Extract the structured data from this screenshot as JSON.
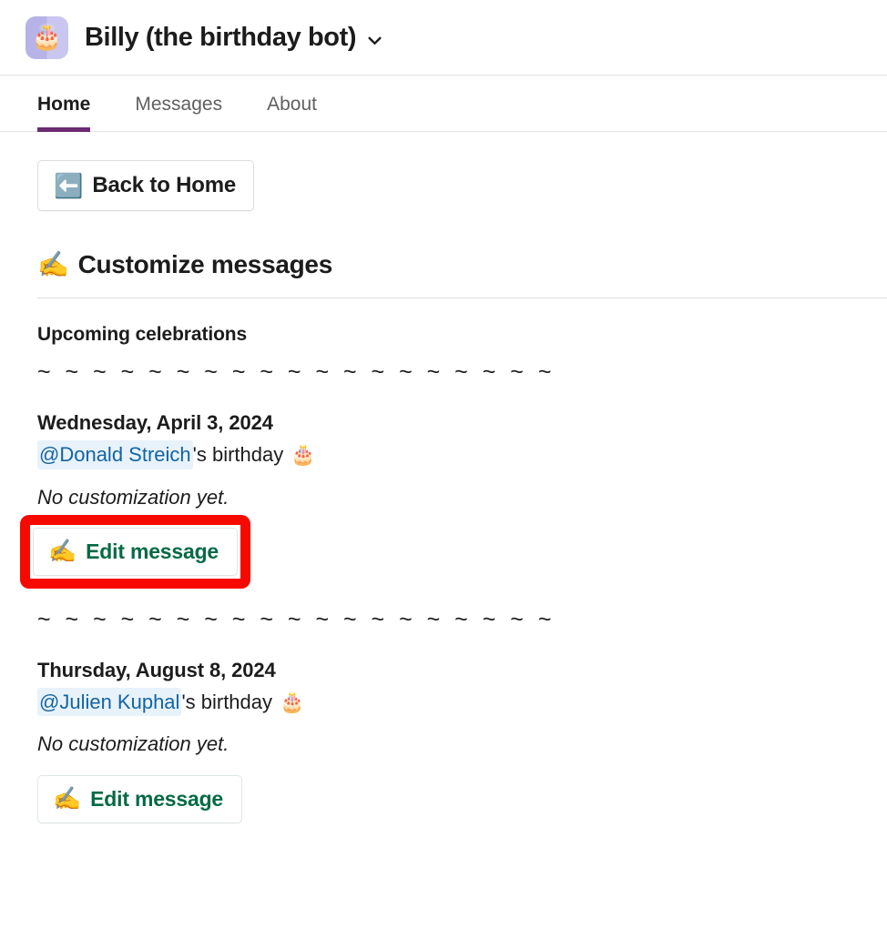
{
  "header": {
    "app_name": "Billy (the birthday bot)",
    "avatar_icon": "birthday-cake-bot-avatar",
    "avatar_emoji": "🎂",
    "dropdown_icon": "chevron-down-icon",
    "avatar_bg_color": "#b7b3e8"
  },
  "tabs": [
    {
      "label": "Home",
      "active": true
    },
    {
      "label": "Messages",
      "active": false
    },
    {
      "label": "About",
      "active": false
    }
  ],
  "tab_accent_color": "#6b2a72",
  "back_button": {
    "label": "Back to Home",
    "emoji": "⬅️",
    "icon": "left-arrow-icon"
  },
  "section": {
    "title": "Customize messages",
    "emoji": "✍️",
    "icon": "writing-hand-icon",
    "subtitle": "Upcoming celebrations"
  },
  "divider_text": "~ ~ ~ ~ ~ ~ ~ ~ ~ ~ ~ ~ ~ ~ ~ ~ ~ ~ ~",
  "celebrations": [
    {
      "date": "Wednesday, April 3, 2024",
      "mention": "@Donald Streich",
      "suffix": "'s birthday",
      "cake_emoji": "🎂",
      "status": "No customization yet.",
      "button_label": "Edit message",
      "button_emoji": "✍️",
      "highlighted": true
    },
    {
      "date": "Thursday, August 8, 2024",
      "mention": "@Julien Kuphal",
      "suffix": "'s birthday",
      "cake_emoji": "🎂",
      "status": "No customization yet.",
      "button_label": "Edit message",
      "button_emoji": "✍️",
      "highlighted": false
    }
  ],
  "colors": {
    "highlight_red": "#f60a00",
    "button_green": "#066a46",
    "mention_blue": "#1264a3",
    "mention_bg": "#e8f2fb",
    "tab_purple": "#6b2a72"
  }
}
